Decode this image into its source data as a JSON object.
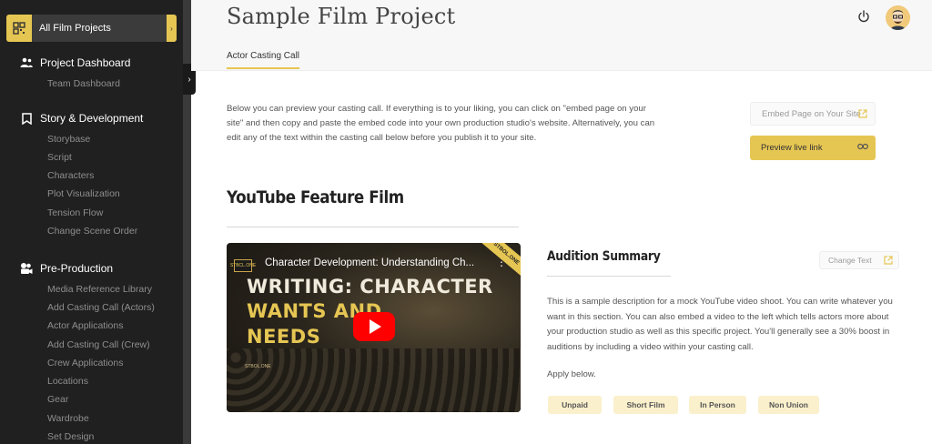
{
  "sidebar": {
    "project_switch_label": "All Film Projects",
    "sections": [
      {
        "label": "Project Dashboard",
        "icon": "team-icon",
        "items": [
          "Team Dashboard"
        ]
      },
      {
        "label": "Story & Development",
        "icon": "bookmark-icon",
        "items": [
          "Storybase",
          "Script",
          "Characters",
          "Plot Visualization",
          "Tension Flow",
          "Change Scene Order"
        ]
      },
      {
        "label": "Pre-Production",
        "icon": "film-icon",
        "items": [
          "Media Reference Library",
          "Add Casting Call (Actors)",
          "Actor Applications",
          "Add Casting Call (Crew)",
          "Crew Applications",
          "Locations",
          "Gear",
          "Wardrobe",
          "Set Design"
        ]
      }
    ]
  },
  "header": {
    "title": "Sample Film Project",
    "tab": "Actor Casting Call"
  },
  "main": {
    "intro": "Below you can preview your casting call. If everything is to your liking, you can click on \"embed page on your site\" and then copy and paste the embed code into your own production studio's website. Alternatively, you can edit any of the text within the casting call below before you publish it to your site.",
    "embed_button": "Embed Page on Your Site",
    "preview_button": "Preview live link",
    "film_title": "YouTube Feature Film",
    "video": {
      "title": "Character Development: Understanding Ch...",
      "channel": "STBCL.ONE",
      "banner": "STBOL.ONE",
      "line1": "WRITING: CHARACTER",
      "line2": "WANTS AND",
      "line3": "NEEDS",
      "watermark": "STBOL.ONE"
    },
    "audition": {
      "title": "Audition Summary",
      "change_button": "Change Text",
      "description": "This is a sample description for a mock YouTube video shoot. You can write whatever you want in this section. You can also embed a video to the left which tells actors more about your production studio as well as this specific project. You'll generally see a 30% boost in auditions by including a video within your casting call.",
      "apply": "Apply below.",
      "tags": [
        "Unpaid",
        "Short Film",
        "In Person",
        "Non Union"
      ]
    }
  },
  "colors": {
    "accent": "#e6c653",
    "sidebar_bg": "#202020",
    "tag_bg": "#faf0cc"
  }
}
